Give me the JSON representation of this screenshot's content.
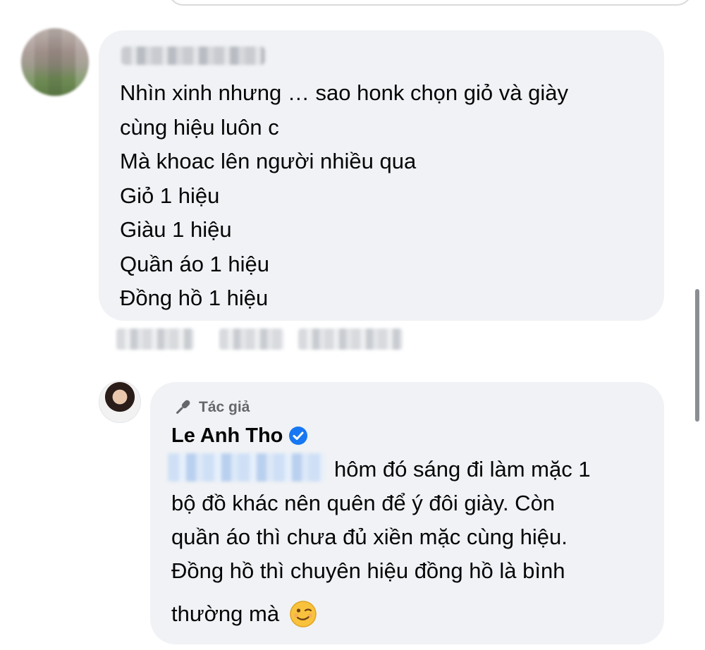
{
  "comment": {
    "lines": [
      "Nhìn xinh nhưng … sao honk chọn giỏ và giày",
      "cùng hiệu luôn c",
      "Mà khoac lên người nhiều qua",
      "Giỏ 1 hiệu",
      "Giàu 1 hiệu",
      "Quần áo 1 hiệu",
      "Đồng hồ 1 hiệu"
    ]
  },
  "reply": {
    "author_label": "Tác giả",
    "author_name": "Le Anh Tho",
    "lines": [
      "hôm đó sáng đi làm mặc 1",
      "bộ đồ khác nên quên để ý đôi giày. Còn",
      "quần áo thì chưa đủ xiền mặc cùng hiệu.",
      "Đồng hồ thì chuyên hiệu đồng hồ là bình",
      "thường mà"
    ]
  },
  "icons": {
    "author_badge": "microphone-icon",
    "verified": "verified-badge-icon",
    "emoji": "winking-face-icon"
  },
  "colors": {
    "bubble": "#f0f2f5",
    "verified": "#1877f2",
    "secondary_text": "#65676b"
  }
}
